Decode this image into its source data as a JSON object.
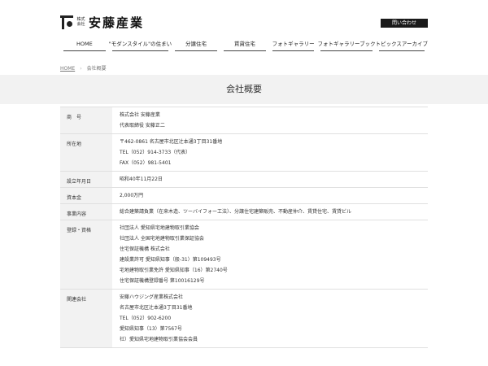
{
  "header": {
    "logo_small": "株式会社",
    "logo_name": "安藤産業",
    "contact_label": "問い合わせ"
  },
  "nav": {
    "items": [
      {
        "label": "HOME"
      },
      {
        "label": "\"モダンスタイル\"の住まい"
      },
      {
        "label": "分譲住宅"
      },
      {
        "label": "賃貸住宅"
      },
      {
        "label": "フォトギャラリー"
      },
      {
        "label": "フォトギャラリーブック"
      },
      {
        "label": "トピックスアーカイブ"
      }
    ]
  },
  "breadcrumb": {
    "home": "HOME",
    "separator": "›",
    "current": "会社概要"
  },
  "page": {
    "title": "会社概要"
  },
  "company_table": {
    "rows": [
      {
        "label": "商　号",
        "values": [
          "株式会社 安藤産業",
          "代表取締役 安藤正二"
        ]
      },
      {
        "label": "所在地",
        "values": [
          "〒462-0861 名古屋市北区辻本通3丁目31番地",
          "TEL（052）914-3733（代表）",
          "FAX（052）981-5401"
        ]
      },
      {
        "label": "設立年月日",
        "values": [
          "昭和40年11月22日"
        ]
      },
      {
        "label": "資本金",
        "values": [
          "2,000万円"
        ]
      },
      {
        "label": "事業内容",
        "values": [
          "総合建築請負業（在来木造、ツーバイフォー工法）、分譲住宅建築販売、不動産仲介、賃貸住宅、賃貸ビル"
        ]
      },
      {
        "label": "登録・資格",
        "values": [
          "社団法人 愛知県宅地建物取引業協会",
          "社団法人 全国宅地建物取引業保証協会",
          "住宅保証機構 株式会社",
          "建設業許可 愛知県知事（般-31）第109493号",
          "宅地建物取引業免許 愛知県知事（16）第2740号",
          "住宅保証機構登録番号 第10016129号"
        ]
      },
      {
        "label": "関連会社",
        "values": [
          "安藤ハウジング産業株式会社",
          "名古屋市北区辻本通3丁目31番地",
          "TEL（052）902-6200",
          "愛知県知事（13）第7567号",
          "社）愛知県宅地建物取引業協会会員"
        ]
      }
    ]
  }
}
